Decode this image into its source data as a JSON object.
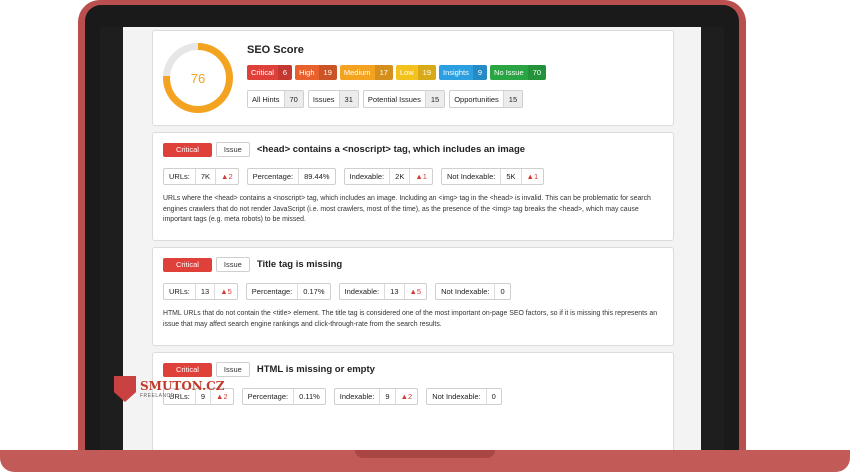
{
  "score": {
    "title": "SEO Score",
    "value": "76",
    "fraction": 0.76,
    "badges": [
      {
        "label": "Critical",
        "count": "6",
        "color": "#e0403a"
      },
      {
        "label": "High",
        "count": "19",
        "color": "#e8602c"
      },
      {
        "label": "Medium",
        "count": "17",
        "color": "#f3a320"
      },
      {
        "label": "Low",
        "count": "19",
        "color": "#f4c21c"
      },
      {
        "label": "Insights",
        "count": "9",
        "color": "#2b9fe0"
      },
      {
        "label": "No Issue",
        "count": "70",
        "color": "#2aa544"
      }
    ],
    "filters": [
      {
        "label": "All Hints",
        "count": "70"
      },
      {
        "label": "Issues",
        "count": "31"
      },
      {
        "label": "Potential Issues",
        "count": "15"
      },
      {
        "label": "Opportunities",
        "count": "15"
      }
    ]
  },
  "issues": [
    {
      "severity": "Critical",
      "type": "Issue",
      "title": "<head> contains a <noscript> tag, which includes an image",
      "metrics": {
        "urls_label": "URLs:",
        "urls": "7K",
        "urls_delta": "▲2",
        "pct_label": "Percentage:",
        "pct": "89.44%",
        "idx_label": "Indexable:",
        "idx": "2K",
        "idx_delta": "▲1",
        "nidx_label": "Not Indexable:",
        "nidx": "5K",
        "nidx_delta": "▲1"
      },
      "description": "URLs where the <head> contains a <noscript> tag, which includes an image. Including an <img> tag in the <head> is invalid. This can be problematic for search engines crawlers that do not render JavaScript (i.e. most crawlers, most of the time), as the presence of the <img> tag breaks the <head>, which may cause important tags (e.g. meta robots) to be missed."
    },
    {
      "severity": "Critical",
      "type": "Issue",
      "title": "Title tag is missing",
      "metrics": {
        "urls_label": "URLs:",
        "urls": "13",
        "urls_delta": "▲5",
        "pct_label": "Percentage:",
        "pct": "0.17%",
        "idx_label": "Indexable:",
        "idx": "13",
        "idx_delta": "▲5",
        "nidx_label": "Not Indexable:",
        "nidx": "0"
      },
      "description": "HTML URLs that do not contain the <title> element. The title tag is considered one of the most important on-page SEO factors, so if it is missing this represents an issue that may affect search engine rankings and click-through-rate from the search results."
    },
    {
      "severity": "Critical",
      "type": "Issue",
      "title": "HTML is missing or empty",
      "metrics": {
        "urls_label": "URLs:",
        "urls": "9",
        "urls_delta": "▲2",
        "pct_label": "Percentage:",
        "pct": "0.11%",
        "idx_label": "Indexable:",
        "idx": "9",
        "idx_delta": "▲2",
        "nidx_label": "Not Indexable:",
        "nidx": "0"
      },
      "description": ""
    }
  ],
  "watermark": {
    "title": "SMUTON.CZ",
    "subtitle": "FREELANCE"
  }
}
